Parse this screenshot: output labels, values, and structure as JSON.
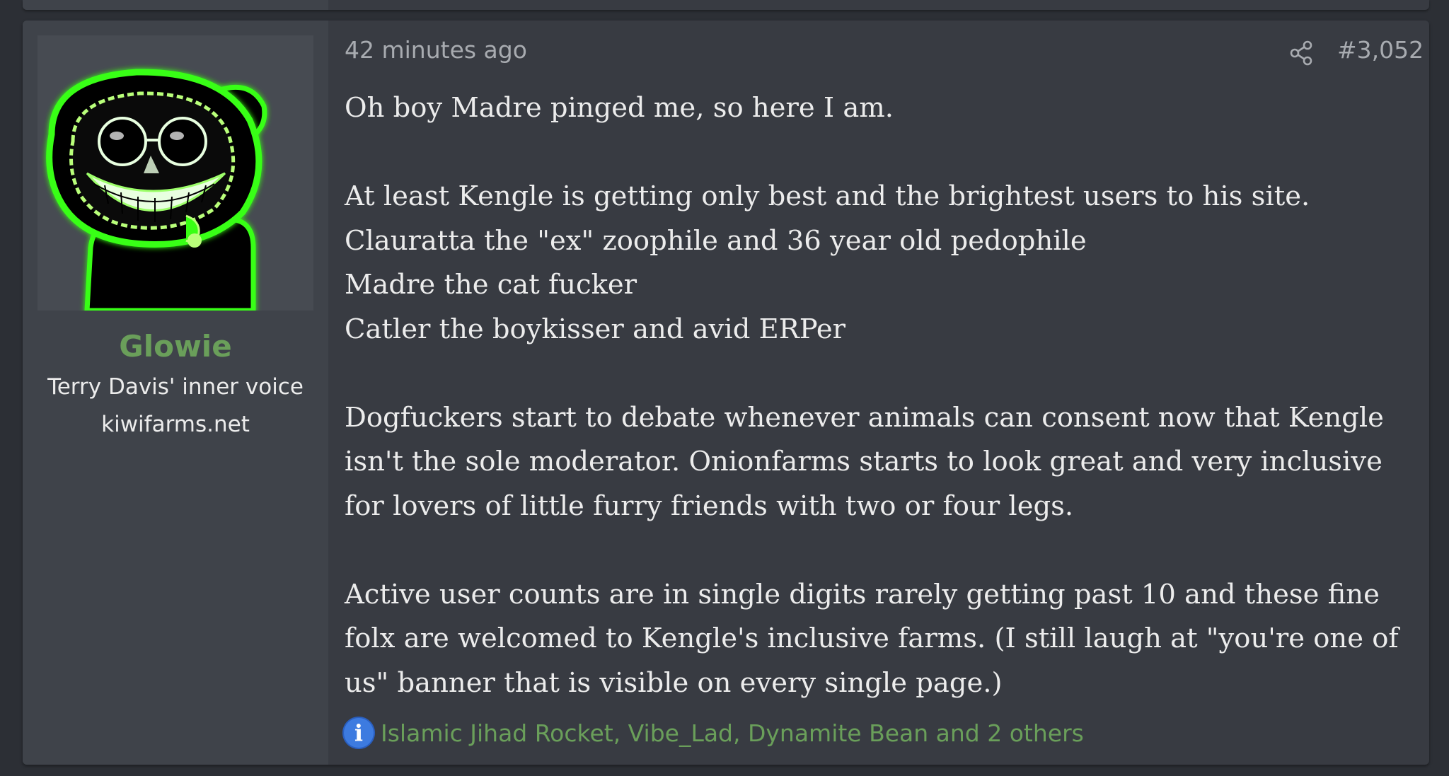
{
  "post": {
    "date": "42 minutes ago",
    "number": "#3,052",
    "paragraphs": [
      [
        "Oh boy Madre pinged me, so here I am."
      ],
      [
        "At least Kengle is getting only best and the brightest users to his site.",
        "Clauratta the \"ex\" zoophile and 36 year old pedophile",
        "Madre the cat fucker",
        "Catler the boykisser and avid ERPer"
      ],
      [
        "Dogfuckers start to debate whenever animals can consent now that Kengle",
        "isn't the sole moderator. Onionfarms starts to look great and very inclusive",
        "for lovers of little furry friends with two or four legs."
      ],
      [
        "Active user counts are in single digits rarely getting past 10 and these fine",
        "folx are welcomed to Kengle's inclusive farms. (I still laugh at \"you're one of",
        "us\" banner that is visible on every single page.)"
      ]
    ],
    "reactions": "Islamic Jihad Rocket, Vibe_Lad, Dynamite Bean and 2 others",
    "reaction_icon_glyph": "i"
  },
  "user": {
    "name": "Glowie",
    "title": "Terry Davis' inner voice",
    "banner": "kiwifarms.net",
    "avatar_icon": "neon-glowing-creature-avatar",
    "name_color": "#6a9f5a"
  },
  "icons": {
    "share": "share-icon",
    "reaction": "info-icon"
  },
  "colors": {
    "background": "#2c2f35",
    "post_bg": "#383b42",
    "user_col_bg": "#3f434a",
    "text": "#ececec",
    "muted": "#a8abb0",
    "link_green": "#6a9f5a",
    "avatar_glow": "#39ff14"
  }
}
